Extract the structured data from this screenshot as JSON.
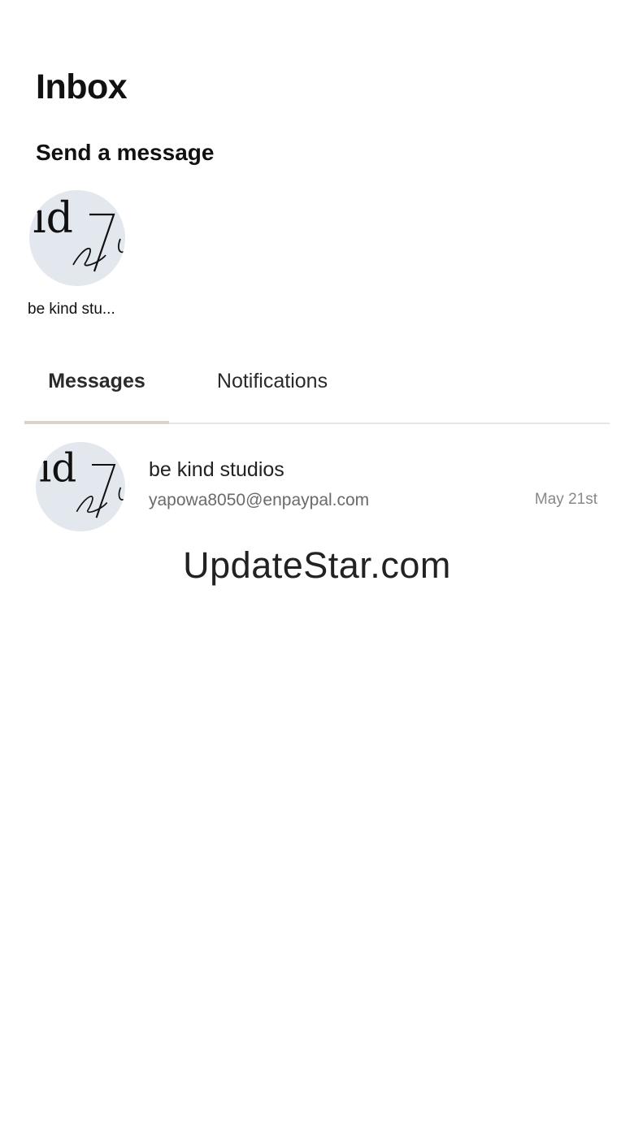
{
  "header": {
    "title": "Inbox"
  },
  "send_message": {
    "title": "Send a message",
    "contacts": [
      {
        "name": "be kind stu...",
        "avatar": "logo-avatar"
      }
    ]
  },
  "tabs": [
    {
      "label": "Messages",
      "active": true
    },
    {
      "label": "Notifications",
      "active": false
    }
  ],
  "threads": [
    {
      "name": "be kind studios",
      "preview": "yapowa8050@enpaypal.com",
      "date": "May 21st",
      "avatar": "logo-avatar"
    }
  ],
  "watermark": "UpdateStar.com",
  "colors": {
    "avatar_bg": "#e3e8ee",
    "tab_underline": "#d8d4c8",
    "divider": "#e6e6e6"
  }
}
